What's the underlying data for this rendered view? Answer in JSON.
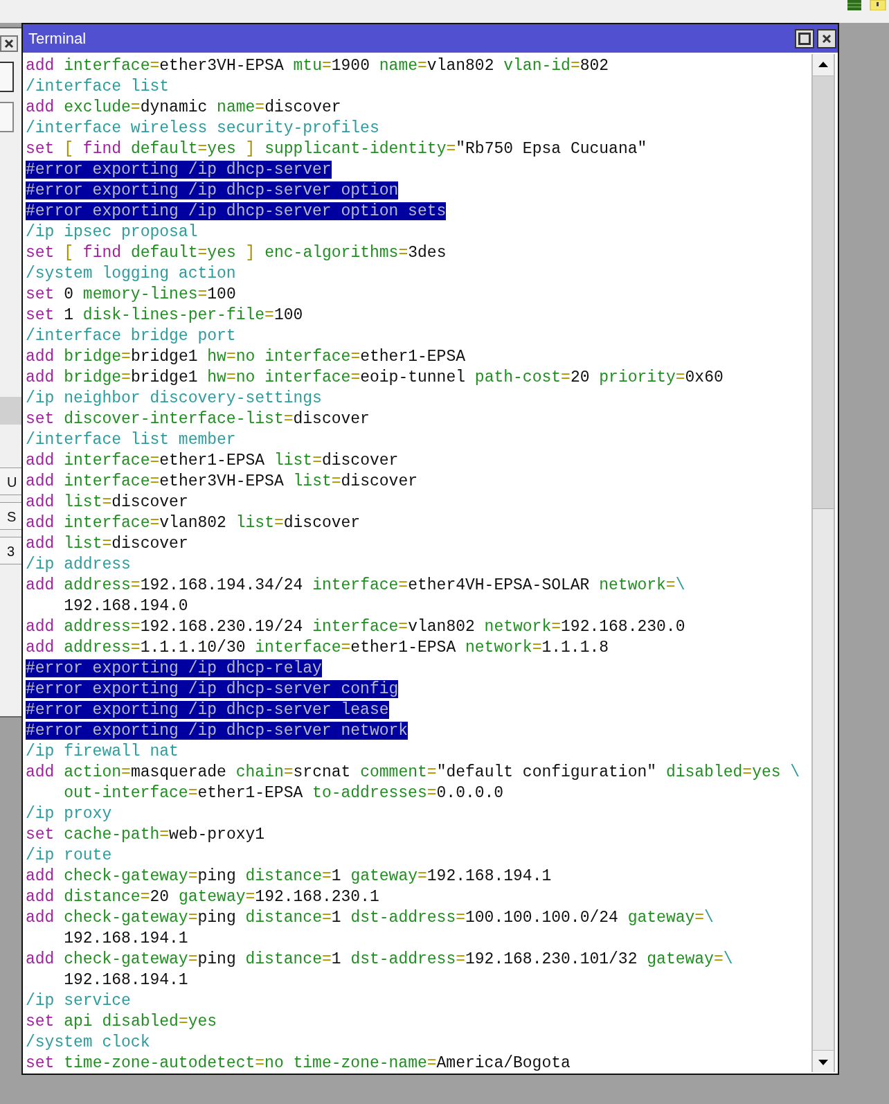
{
  "window": {
    "title": "Terminal"
  },
  "side_window": {
    "buttons": [
      "U",
      "S",
      "3"
    ]
  },
  "lines": [
    {
      "selected": false,
      "continued": false,
      "words": [
        [
          {
            "kind": "cmd",
            "text": "add"
          }
        ],
        [
          {
            "kind": "key",
            "text": "interface"
          },
          {
            "kind": "eq",
            "text": "="
          },
          {
            "kind": "val",
            "text": "ether3VH-EPSA"
          }
        ],
        [
          {
            "kind": "key",
            "text": "mtu"
          },
          {
            "kind": "eq",
            "text": "="
          },
          {
            "kind": "val",
            "text": "1900"
          }
        ],
        [
          {
            "kind": "key",
            "text": "name"
          },
          {
            "kind": "eq",
            "text": "="
          },
          {
            "kind": "val",
            "text": "vlan802"
          }
        ],
        [
          {
            "kind": "key",
            "text": "vlan-id"
          },
          {
            "kind": "eq",
            "text": "="
          },
          {
            "kind": "val",
            "text": "802"
          }
        ]
      ]
    },
    {
      "selected": false,
      "continued": false,
      "words": [
        [
          {
            "kind": "path",
            "text": "/interface list"
          }
        ]
      ]
    },
    {
      "selected": false,
      "continued": false,
      "words": [
        [
          {
            "kind": "cmd",
            "text": "add"
          }
        ],
        [
          {
            "kind": "key",
            "text": "exclude"
          },
          {
            "kind": "eq",
            "text": "="
          },
          {
            "kind": "val",
            "text": "dynamic"
          }
        ],
        [
          {
            "kind": "key",
            "text": "name"
          },
          {
            "kind": "eq",
            "text": "="
          },
          {
            "kind": "val",
            "text": "discover"
          }
        ]
      ]
    },
    {
      "selected": false,
      "continued": false,
      "words": [
        [
          {
            "kind": "path",
            "text": "/interface wireless security-profiles"
          }
        ]
      ]
    },
    {
      "selected": false,
      "continued": false,
      "words": [
        [
          {
            "kind": "cmd",
            "text": "set"
          }
        ],
        [
          {
            "kind": "eq",
            "text": "["
          }
        ],
        [
          {
            "kind": "cmd",
            "text": "find"
          }
        ],
        [
          {
            "kind": "key",
            "text": "default"
          },
          {
            "kind": "eq",
            "text": "="
          },
          {
            "kind": "key",
            "text": "yes"
          }
        ],
        [
          {
            "kind": "eq",
            "text": "]"
          }
        ],
        [
          {
            "kind": "key",
            "text": "supplicant-identity"
          },
          {
            "kind": "eq",
            "text": "="
          },
          {
            "kind": "val",
            "text": "\"Rb750 Epsa Cucuana\""
          }
        ]
      ]
    },
    {
      "selected": true,
      "continued": false,
      "words": [
        [
          {
            "kind": "error",
            "text": "#error exporting /ip dhcp-server"
          }
        ]
      ]
    },
    {
      "selected": true,
      "continued": false,
      "words": [
        [
          {
            "kind": "error",
            "text": "#error exporting /ip dhcp-server option"
          }
        ]
      ]
    },
    {
      "selected": true,
      "continued": false,
      "words": [
        [
          {
            "kind": "error",
            "text": "#error exporting /ip dhcp-server option sets"
          }
        ]
      ]
    },
    {
      "selected": false,
      "continued": false,
      "words": [
        [
          {
            "kind": "path",
            "text": "/ip ipsec proposal"
          }
        ]
      ]
    },
    {
      "selected": false,
      "continued": false,
      "words": [
        [
          {
            "kind": "cmd",
            "text": "set"
          }
        ],
        [
          {
            "kind": "eq",
            "text": "["
          }
        ],
        [
          {
            "kind": "cmd",
            "text": "find"
          }
        ],
        [
          {
            "kind": "key",
            "text": "default"
          },
          {
            "kind": "eq",
            "text": "="
          },
          {
            "kind": "key",
            "text": "yes"
          }
        ],
        [
          {
            "kind": "eq",
            "text": "]"
          }
        ],
        [
          {
            "kind": "key",
            "text": "enc-algorithms"
          },
          {
            "kind": "eq",
            "text": "="
          },
          {
            "kind": "val",
            "text": "3des"
          }
        ]
      ]
    },
    {
      "selected": false,
      "continued": false,
      "words": [
        [
          {
            "kind": "path",
            "text": "/system logging action"
          }
        ]
      ]
    },
    {
      "selected": false,
      "continued": false,
      "words": [
        [
          {
            "kind": "cmd",
            "text": "set"
          }
        ],
        [
          {
            "kind": "val",
            "text": "0"
          }
        ],
        [
          {
            "kind": "key",
            "text": "memory-lines"
          },
          {
            "kind": "eq",
            "text": "="
          },
          {
            "kind": "val",
            "text": "100"
          }
        ]
      ]
    },
    {
      "selected": false,
      "continued": false,
      "words": [
        [
          {
            "kind": "cmd",
            "text": "set"
          }
        ],
        [
          {
            "kind": "val",
            "text": "1"
          }
        ],
        [
          {
            "kind": "key",
            "text": "disk-lines-per-file"
          },
          {
            "kind": "eq",
            "text": "="
          },
          {
            "kind": "val",
            "text": "100"
          }
        ]
      ]
    },
    {
      "selected": false,
      "continued": false,
      "words": [
        [
          {
            "kind": "path",
            "text": "/interface bridge port"
          }
        ]
      ]
    },
    {
      "selected": false,
      "continued": false,
      "words": [
        [
          {
            "kind": "cmd",
            "text": "add"
          }
        ],
        [
          {
            "kind": "key",
            "text": "bridge"
          },
          {
            "kind": "eq",
            "text": "="
          },
          {
            "kind": "val",
            "text": "bridge1"
          }
        ],
        [
          {
            "kind": "key",
            "text": "hw"
          },
          {
            "kind": "eq",
            "text": "="
          },
          {
            "kind": "key",
            "text": "no"
          }
        ],
        [
          {
            "kind": "key",
            "text": "interface"
          },
          {
            "kind": "eq",
            "text": "="
          },
          {
            "kind": "val",
            "text": "ether1-EPSA"
          }
        ]
      ]
    },
    {
      "selected": false,
      "continued": false,
      "words": [
        [
          {
            "kind": "cmd",
            "text": "add"
          }
        ],
        [
          {
            "kind": "key",
            "text": "bridge"
          },
          {
            "kind": "eq",
            "text": "="
          },
          {
            "kind": "val",
            "text": "bridge1"
          }
        ],
        [
          {
            "kind": "key",
            "text": "hw"
          },
          {
            "kind": "eq",
            "text": "="
          },
          {
            "kind": "key",
            "text": "no"
          }
        ],
        [
          {
            "kind": "key",
            "text": "interface"
          },
          {
            "kind": "eq",
            "text": "="
          },
          {
            "kind": "val",
            "text": "eoip-tunnel"
          }
        ],
        [
          {
            "kind": "key",
            "text": "path-cost"
          },
          {
            "kind": "eq",
            "text": "="
          },
          {
            "kind": "val",
            "text": "20"
          }
        ],
        [
          {
            "kind": "key",
            "text": "priority"
          },
          {
            "kind": "eq",
            "text": "="
          },
          {
            "kind": "val",
            "text": "0x60"
          }
        ]
      ]
    },
    {
      "selected": false,
      "continued": false,
      "words": [
        [
          {
            "kind": "path",
            "text": "/ip neighbor discovery-settings"
          }
        ]
      ]
    },
    {
      "selected": false,
      "continued": false,
      "words": [
        [
          {
            "kind": "cmd",
            "text": "set"
          }
        ],
        [
          {
            "kind": "key",
            "text": "discover-interface-list"
          },
          {
            "kind": "eq",
            "text": "="
          },
          {
            "kind": "val",
            "text": "discover"
          }
        ]
      ]
    },
    {
      "selected": false,
      "continued": false,
      "words": [
        [
          {
            "kind": "path",
            "text": "/interface list member"
          }
        ]
      ]
    },
    {
      "selected": false,
      "continued": false,
      "words": [
        [
          {
            "kind": "cmd",
            "text": "add"
          }
        ],
        [
          {
            "kind": "key",
            "text": "interface"
          },
          {
            "kind": "eq",
            "text": "="
          },
          {
            "kind": "val",
            "text": "ether1-EPSA"
          }
        ],
        [
          {
            "kind": "key",
            "text": "list"
          },
          {
            "kind": "eq",
            "text": "="
          },
          {
            "kind": "val",
            "text": "discover"
          }
        ]
      ]
    },
    {
      "selected": false,
      "continued": false,
      "words": [
        [
          {
            "kind": "cmd",
            "text": "add"
          }
        ],
        [
          {
            "kind": "key",
            "text": "interface"
          },
          {
            "kind": "eq",
            "text": "="
          },
          {
            "kind": "val",
            "text": "ether3VH-EPSA"
          }
        ],
        [
          {
            "kind": "key",
            "text": "list"
          },
          {
            "kind": "eq",
            "text": "="
          },
          {
            "kind": "val",
            "text": "discover"
          }
        ]
      ]
    },
    {
      "selected": false,
      "continued": false,
      "words": [
        [
          {
            "kind": "cmd",
            "text": "add"
          }
        ],
        [
          {
            "kind": "key",
            "text": "list"
          },
          {
            "kind": "eq",
            "text": "="
          },
          {
            "kind": "val",
            "text": "discover"
          }
        ]
      ]
    },
    {
      "selected": false,
      "continued": false,
      "words": [
        [
          {
            "kind": "cmd",
            "text": "add"
          }
        ],
        [
          {
            "kind": "key",
            "text": "interface"
          },
          {
            "kind": "eq",
            "text": "="
          },
          {
            "kind": "val",
            "text": "vlan802"
          }
        ],
        [
          {
            "kind": "key",
            "text": "list"
          },
          {
            "kind": "eq",
            "text": "="
          },
          {
            "kind": "val",
            "text": "discover"
          }
        ]
      ]
    },
    {
      "selected": false,
      "continued": false,
      "words": [
        [
          {
            "kind": "cmd",
            "text": "add"
          }
        ],
        [
          {
            "kind": "key",
            "text": "list"
          },
          {
            "kind": "eq",
            "text": "="
          },
          {
            "kind": "val",
            "text": "discover"
          }
        ]
      ]
    },
    {
      "selected": false,
      "continued": false,
      "words": [
        [
          {
            "kind": "path",
            "text": "/ip address"
          }
        ]
      ]
    },
    {
      "selected": false,
      "continued": false,
      "words": [
        [
          {
            "kind": "cmd",
            "text": "add"
          }
        ],
        [
          {
            "kind": "key",
            "text": "address"
          },
          {
            "kind": "eq",
            "text": "="
          },
          {
            "kind": "val",
            "text": "192.168.194.34/24"
          }
        ],
        [
          {
            "kind": "key",
            "text": "interface"
          },
          {
            "kind": "eq",
            "text": "="
          },
          {
            "kind": "val",
            "text": "ether4VH-EPSA-SOLAR"
          }
        ],
        [
          {
            "kind": "key",
            "text": "network"
          },
          {
            "kind": "eq",
            "text": "="
          },
          {
            "kind": "path",
            "text": "\\"
          }
        ]
      ]
    },
    {
      "selected": false,
      "continued": true,
      "words": [
        [
          {
            "kind": "val",
            "text": "192.168.194.0"
          }
        ]
      ]
    },
    {
      "selected": false,
      "continued": false,
      "words": [
        [
          {
            "kind": "cmd",
            "text": "add"
          }
        ],
        [
          {
            "kind": "key",
            "text": "address"
          },
          {
            "kind": "eq",
            "text": "="
          },
          {
            "kind": "val",
            "text": "192.168.230.19/24"
          }
        ],
        [
          {
            "kind": "key",
            "text": "interface"
          },
          {
            "kind": "eq",
            "text": "="
          },
          {
            "kind": "val",
            "text": "vlan802"
          }
        ],
        [
          {
            "kind": "key",
            "text": "network"
          },
          {
            "kind": "eq",
            "text": "="
          },
          {
            "kind": "val",
            "text": "192.168.230.0"
          }
        ]
      ]
    },
    {
      "selected": false,
      "continued": false,
      "words": [
        [
          {
            "kind": "cmd",
            "text": "add"
          }
        ],
        [
          {
            "kind": "key",
            "text": "address"
          },
          {
            "kind": "eq",
            "text": "="
          },
          {
            "kind": "val",
            "text": "1.1.1.10/30"
          }
        ],
        [
          {
            "kind": "key",
            "text": "interface"
          },
          {
            "kind": "eq",
            "text": "="
          },
          {
            "kind": "val",
            "text": "ether1-EPSA"
          }
        ],
        [
          {
            "kind": "key",
            "text": "network"
          },
          {
            "kind": "eq",
            "text": "="
          },
          {
            "kind": "val",
            "text": "1.1.1.8"
          }
        ]
      ]
    },
    {
      "selected": true,
      "continued": false,
      "words": [
        [
          {
            "kind": "error",
            "text": "#error exporting /ip dhcp-relay"
          }
        ]
      ]
    },
    {
      "selected": true,
      "continued": false,
      "words": [
        [
          {
            "kind": "error",
            "text": "#error exporting /ip dhcp-server config"
          }
        ]
      ]
    },
    {
      "selected": true,
      "continued": false,
      "words": [
        [
          {
            "kind": "error",
            "text": "#error exporting /ip dhcp-server lease"
          }
        ]
      ]
    },
    {
      "selected": true,
      "continued": false,
      "words": [
        [
          {
            "kind": "error",
            "text": "#error exporting /ip dhcp-server network"
          }
        ]
      ]
    },
    {
      "selected": false,
      "continued": false,
      "words": [
        [
          {
            "kind": "path",
            "text": "/ip firewall nat"
          }
        ]
      ]
    },
    {
      "selected": false,
      "continued": false,
      "words": [
        [
          {
            "kind": "cmd",
            "text": "add"
          }
        ],
        [
          {
            "kind": "key",
            "text": "action"
          },
          {
            "kind": "eq",
            "text": "="
          },
          {
            "kind": "val",
            "text": "masquerade"
          }
        ],
        [
          {
            "kind": "key",
            "text": "chain"
          },
          {
            "kind": "eq",
            "text": "="
          },
          {
            "kind": "val",
            "text": "srcnat"
          }
        ],
        [
          {
            "kind": "key",
            "text": "comment"
          },
          {
            "kind": "eq",
            "text": "="
          },
          {
            "kind": "val",
            "text": "\"default configuration\""
          }
        ],
        [
          {
            "kind": "key",
            "text": "disabled"
          },
          {
            "kind": "eq",
            "text": "="
          },
          {
            "kind": "key",
            "text": "yes"
          }
        ],
        [
          {
            "kind": "path",
            "text": "\\"
          }
        ]
      ]
    },
    {
      "selected": false,
      "continued": true,
      "words": [
        [
          {
            "kind": "key",
            "text": "out-interface"
          },
          {
            "kind": "eq",
            "text": "="
          },
          {
            "kind": "val",
            "text": "ether1-EPSA"
          }
        ],
        [
          {
            "kind": "key",
            "text": "to-addresses"
          },
          {
            "kind": "eq",
            "text": "="
          },
          {
            "kind": "val",
            "text": "0.0.0.0"
          }
        ]
      ]
    },
    {
      "selected": false,
      "continued": false,
      "words": [
        [
          {
            "kind": "path",
            "text": "/ip proxy"
          }
        ]
      ]
    },
    {
      "selected": false,
      "continued": false,
      "words": [
        [
          {
            "kind": "cmd",
            "text": "set"
          }
        ],
        [
          {
            "kind": "key",
            "text": "cache-path"
          },
          {
            "kind": "eq",
            "text": "="
          },
          {
            "kind": "val",
            "text": "web-proxy1"
          }
        ]
      ]
    },
    {
      "selected": false,
      "continued": false,
      "words": [
        [
          {
            "kind": "path",
            "text": "/ip route"
          }
        ]
      ]
    },
    {
      "selected": false,
      "continued": false,
      "words": [
        [
          {
            "kind": "cmd",
            "text": "add"
          }
        ],
        [
          {
            "kind": "key",
            "text": "check-gateway"
          },
          {
            "kind": "eq",
            "text": "="
          },
          {
            "kind": "val",
            "text": "ping"
          }
        ],
        [
          {
            "kind": "key",
            "text": "distance"
          },
          {
            "kind": "eq",
            "text": "="
          },
          {
            "kind": "val",
            "text": "1"
          }
        ],
        [
          {
            "kind": "key",
            "text": "gateway"
          },
          {
            "kind": "eq",
            "text": "="
          },
          {
            "kind": "val",
            "text": "192.168.194.1"
          }
        ]
      ]
    },
    {
      "selected": false,
      "continued": false,
      "words": [
        [
          {
            "kind": "cmd",
            "text": "add"
          }
        ],
        [
          {
            "kind": "key",
            "text": "distance"
          },
          {
            "kind": "eq",
            "text": "="
          },
          {
            "kind": "val",
            "text": "20"
          }
        ],
        [
          {
            "kind": "key",
            "text": "gateway"
          },
          {
            "kind": "eq",
            "text": "="
          },
          {
            "kind": "val",
            "text": "192.168.230.1"
          }
        ]
      ]
    },
    {
      "selected": false,
      "continued": false,
      "words": [
        [
          {
            "kind": "cmd",
            "text": "add"
          }
        ],
        [
          {
            "kind": "key",
            "text": "check-gateway"
          },
          {
            "kind": "eq",
            "text": "="
          },
          {
            "kind": "val",
            "text": "ping"
          }
        ],
        [
          {
            "kind": "key",
            "text": "distance"
          },
          {
            "kind": "eq",
            "text": "="
          },
          {
            "kind": "val",
            "text": "1"
          }
        ],
        [
          {
            "kind": "key",
            "text": "dst-address"
          },
          {
            "kind": "eq",
            "text": "="
          },
          {
            "kind": "val",
            "text": "100.100.100.0/24"
          }
        ],
        [
          {
            "kind": "key",
            "text": "gateway"
          },
          {
            "kind": "eq",
            "text": "="
          },
          {
            "kind": "path",
            "text": "\\"
          }
        ]
      ]
    },
    {
      "selected": false,
      "continued": true,
      "words": [
        [
          {
            "kind": "val",
            "text": "192.168.194.1"
          }
        ]
      ]
    },
    {
      "selected": false,
      "continued": false,
      "words": [
        [
          {
            "kind": "cmd",
            "text": "add"
          }
        ],
        [
          {
            "kind": "key",
            "text": "check-gateway"
          },
          {
            "kind": "eq",
            "text": "="
          },
          {
            "kind": "val",
            "text": "ping"
          }
        ],
        [
          {
            "kind": "key",
            "text": "distance"
          },
          {
            "kind": "eq",
            "text": "="
          },
          {
            "kind": "val",
            "text": "1"
          }
        ],
        [
          {
            "kind": "key",
            "text": "dst-address"
          },
          {
            "kind": "eq",
            "text": "="
          },
          {
            "kind": "val",
            "text": "192.168.230.101/32"
          }
        ],
        [
          {
            "kind": "key",
            "text": "gateway"
          },
          {
            "kind": "eq",
            "text": "="
          },
          {
            "kind": "path",
            "text": "\\"
          }
        ]
      ]
    },
    {
      "selected": false,
      "continued": true,
      "words": [
        [
          {
            "kind": "val",
            "text": "192.168.194.1"
          }
        ]
      ]
    },
    {
      "selected": false,
      "continued": false,
      "words": [
        [
          {
            "kind": "path",
            "text": "/ip service"
          }
        ]
      ]
    },
    {
      "selected": false,
      "continued": false,
      "words": [
        [
          {
            "kind": "cmd",
            "text": "set"
          }
        ],
        [
          {
            "kind": "key",
            "text": "api"
          }
        ],
        [
          {
            "kind": "key",
            "text": "disabled"
          },
          {
            "kind": "eq",
            "text": "="
          },
          {
            "kind": "key",
            "text": "yes"
          }
        ]
      ]
    },
    {
      "selected": false,
      "continued": false,
      "words": [
        [
          {
            "kind": "path",
            "text": "/system clock"
          }
        ]
      ]
    },
    {
      "selected": false,
      "continued": false,
      "words": [
        [
          {
            "kind": "cmd",
            "text": "set"
          }
        ],
        [
          {
            "kind": "key",
            "text": "time-zone-autodetect"
          },
          {
            "kind": "eq",
            "text": "="
          },
          {
            "kind": "key",
            "text": "no"
          }
        ],
        [
          {
            "kind": "key",
            "text": "time-zone-name"
          },
          {
            "kind": "eq",
            "text": "="
          },
          {
            "kind": "val",
            "text": "America/Bogota"
          }
        ]
      ]
    }
  ]
}
